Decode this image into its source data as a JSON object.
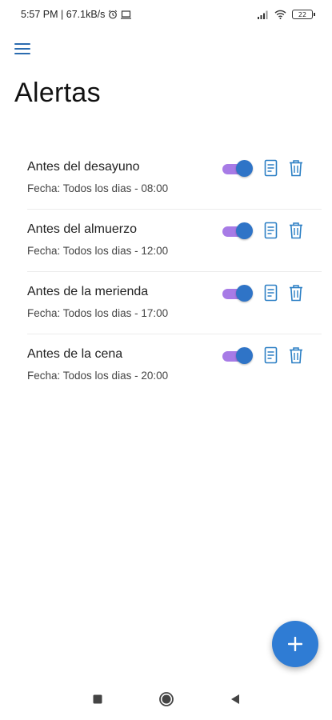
{
  "status_bar": {
    "time_and_speed": "5:57 PM | 67.1kB/s",
    "battery": "22",
    "icons": [
      "alarm-icon",
      "cast-icon",
      "signal-icon",
      "wifi-icon",
      "battery-icon"
    ]
  },
  "header": {
    "menu_icon": "hamburger-menu-icon",
    "title": "Alertas"
  },
  "alerts": [
    {
      "name": "Antes del desayuno",
      "detail": "Fecha: Todos los dias - 08:00",
      "enabled": true
    },
    {
      "name": "Antes del almuerzo",
      "detail": "Fecha: Todos los dias - 12:00",
      "enabled": true
    },
    {
      "name": "Antes de la merienda",
      "detail": "Fecha: Todos los dias - 17:00",
      "enabled": true
    },
    {
      "name": "Antes de la cena",
      "detail": "Fecha: Todos los dias - 20:00",
      "enabled": true
    }
  ],
  "fab": {
    "label": "+",
    "icon": "plus-icon"
  },
  "nav_bar": {
    "icons": [
      "square-recents-icon",
      "circle-home-icon",
      "triangle-back-icon"
    ]
  },
  "colors": {
    "accent": "#2f74c7",
    "toggle_track": "#a77be6",
    "icon_blue": "#2b7fc4",
    "fab": "#2f7cd4"
  }
}
